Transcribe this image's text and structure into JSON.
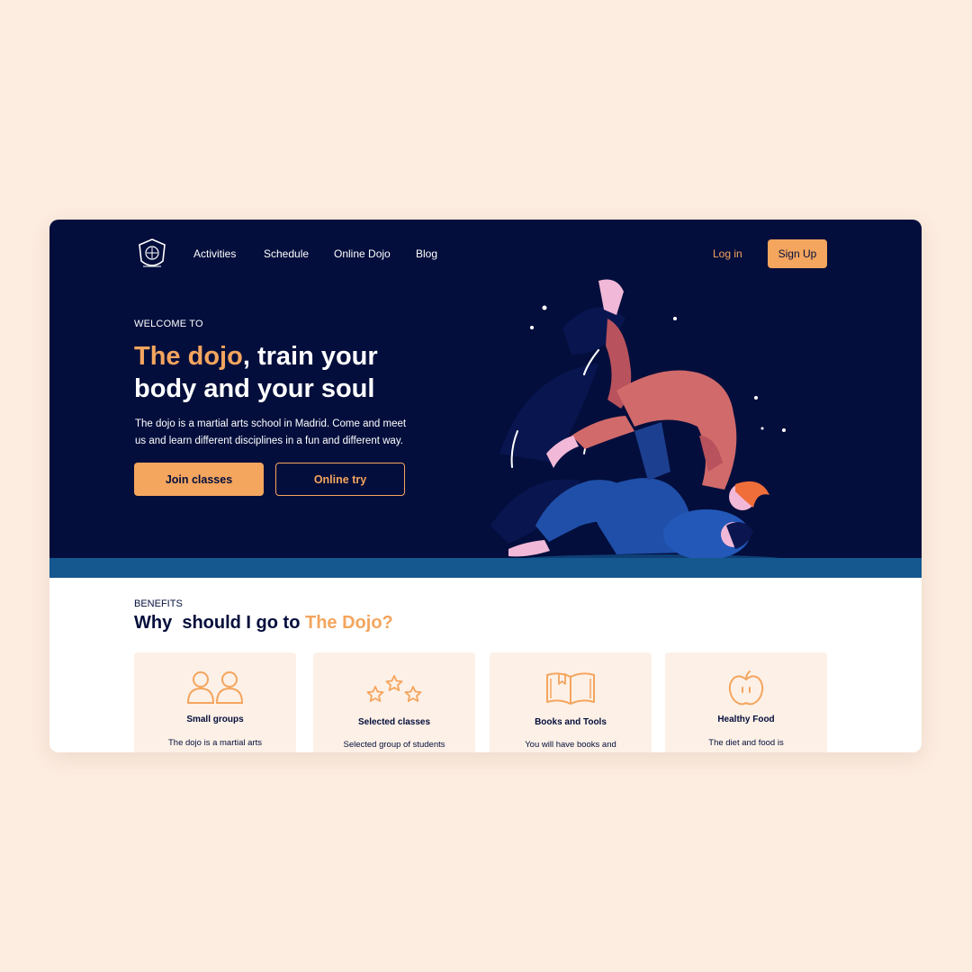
{
  "nav": {
    "logo_label": "Dojo crest",
    "items": [
      "Activities",
      "Schedule",
      "Online Dojo",
      "Blog"
    ],
    "login": "Log in",
    "signup": "Sign Up"
  },
  "hero": {
    "eyebrow": "WELCOME TO",
    "headline_accent": "The dojo",
    "headline_rest": ", train your body and your soul",
    "lede": "The dojo is a martial arts school in Madrid. Come and meet us and learn different disciplines in a fun and different way.",
    "primary_button": "Join classes",
    "secondary_button": "Online try"
  },
  "benefits": {
    "eyebrow": "BENEFITS",
    "title_prefix": "Why  should I go to ",
    "title_accent": "The Dojo?",
    "cards": [
      {
        "icon": "people-icon",
        "title": "Small groups",
        "text": "The dojo is a martial arts"
      },
      {
        "icon": "stars-icon",
        "title": "Selected classes",
        "text": "Selected group of students"
      },
      {
        "icon": "book-icon",
        "title": "Books and Tools",
        "text": "You will have books and"
      },
      {
        "icon": "apple-icon",
        "title": "Healthy Food",
        "text": "The diet and food is"
      }
    ]
  },
  "colors": {
    "page_background": "#fdece0",
    "hero_background": "#030e3c",
    "accent": "#f4a55e",
    "mat": "#14588f",
    "card_background": "#fdf0e6"
  }
}
